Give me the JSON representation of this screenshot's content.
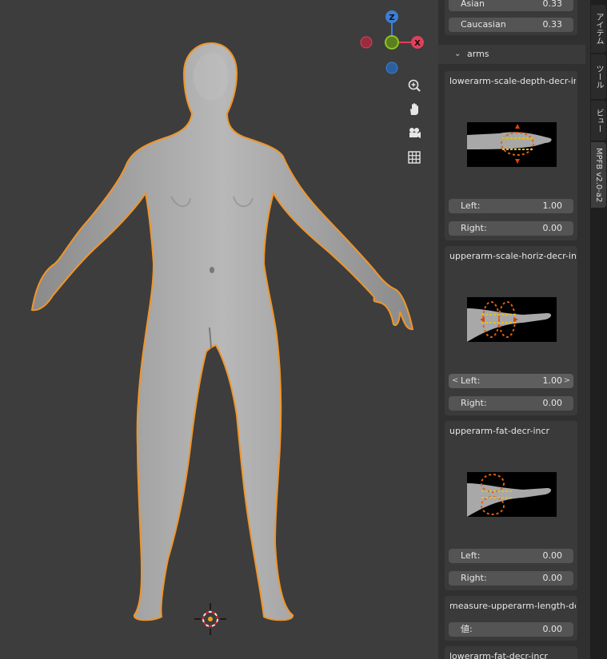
{
  "viewport": {
    "gizmo": {
      "z": "Z",
      "x": "X"
    }
  },
  "nav": {
    "zoom_icon": "zoom-icon",
    "pan_icon": "hand-icon",
    "camera_icon": "camera-icon",
    "grid_icon": "grid-icon"
  },
  "panel": {
    "top_fields": [
      {
        "label": "Asian",
        "value": "0.33"
      },
      {
        "label": "Caucasian",
        "value": "0.33"
      }
    ],
    "section": "arms",
    "boxes": [
      {
        "title": "lowerarm-scale-depth-decr-incr",
        "fields": [
          {
            "label": "Left:",
            "value": "1.00"
          },
          {
            "label": "Right:",
            "value": "0.00"
          }
        ]
      },
      {
        "title": "upperarm-scale-horiz-decr-incr",
        "fields": [
          {
            "label": "Left:",
            "value": "1.00"
          },
          {
            "label": "Right:",
            "value": "0.00"
          }
        ]
      },
      {
        "title": "upperarm-fat-decr-incr",
        "fields": [
          {
            "label": "Left:",
            "value": "0.00"
          },
          {
            "label": "Right:",
            "value": "0.00"
          }
        ]
      },
      {
        "title": "measure-upperarm-length-dec...",
        "fields": [
          {
            "label": "値:",
            "value": "0.00"
          }
        ]
      },
      {
        "title": "lowerarm-fat-decr-incr"
      }
    ]
  },
  "tabs": [
    "アイテム",
    "ツール",
    "ビュー",
    "MPFB v2.0-a2"
  ],
  "colors": {
    "viewport_bg": "#3d3d3d",
    "panel_bg": "#303030",
    "selection_outline": "#f0952a",
    "axis_x": "#e0405a",
    "axis_y": "#8ac423",
    "axis_z": "#3b7fd6"
  }
}
